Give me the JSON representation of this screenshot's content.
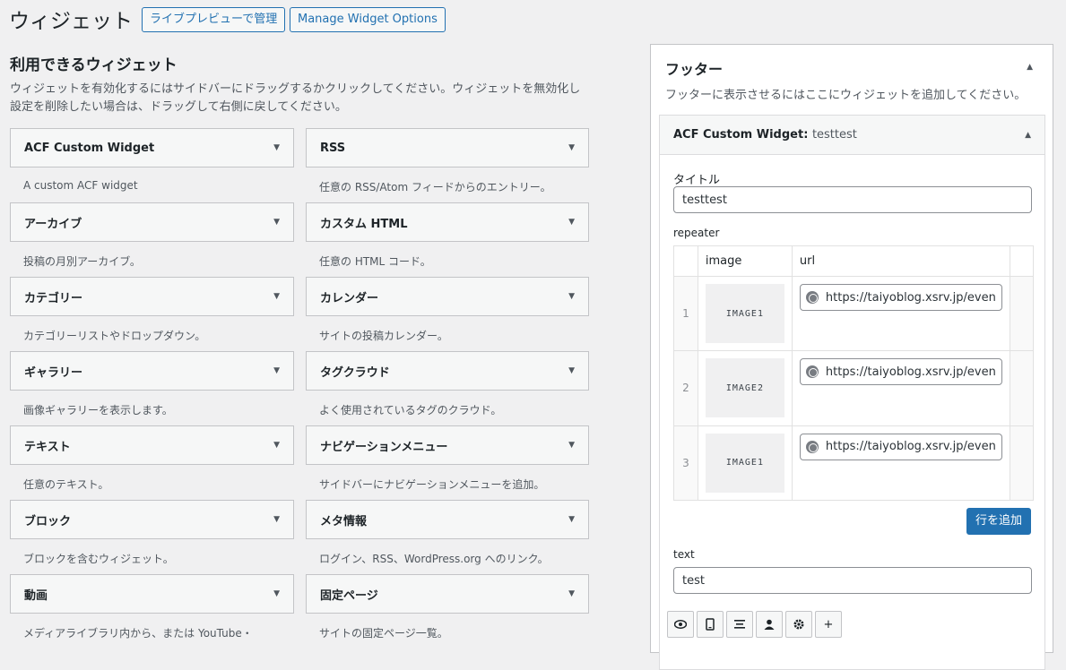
{
  "header": {
    "title": "ウィジェット",
    "live_preview_button": "ライブプレビューで管理",
    "manage_button": "Manage Widget Options"
  },
  "available": {
    "title": "利用できるウィジェット",
    "description": "ウィジェットを有効化するにはサイドバーにドラッグするかクリックしてください。ウィジェットを無効化し設定を削除したい場合は、ドラッグして右側に戻してください。",
    "description_line1": "ウィジェットを有効化するにはサイドバーにドラッグするかクリックしてください。ウィジェットを無効化し",
    "description_line2": "設定を削除したい場合は、ドラッグして右側に戻してください。",
    "widgets": [
      {
        "name": "ACF Custom Widget",
        "desc": "A custom ACF widget"
      },
      {
        "name": "RSS",
        "desc": "任意の RSS/Atom フィードからのエントリー。"
      },
      {
        "name": "アーカイブ",
        "desc": "投稿の月別アーカイブ。"
      },
      {
        "name": "カスタム HTML",
        "desc": "任意の HTML コード。"
      },
      {
        "name": "カテゴリー",
        "desc": "カテゴリーリストやドロップダウン。"
      },
      {
        "name": "カレンダー",
        "desc": "サイトの投稿カレンダー。"
      },
      {
        "name": "ギャラリー",
        "desc": "画像ギャラリーを表示します。"
      },
      {
        "name": "タグクラウド",
        "desc": "よく使用されているタグのクラウド。"
      },
      {
        "name": "テキスト",
        "desc": "任意のテキスト。"
      },
      {
        "name": "ナビゲーションメニュー",
        "desc": "サイドバーにナビゲーションメニューを追加。"
      },
      {
        "name": "ブロック",
        "desc": "ブロックを含むウィジェット。"
      },
      {
        "name": "メタ情報",
        "desc": "ログイン、RSS、WordPress.org へのリンク。"
      },
      {
        "name": "動画",
        "desc": "メディアライブラリ内から、または YouTube・"
      },
      {
        "name": "固定ページ",
        "desc": "サイトの固定ページ一覧。"
      }
    ]
  },
  "footer_sidebar": {
    "title": "フッター",
    "description": "フッターに表示させるにはここにウィジェットを追加してください。",
    "widget": {
      "title": "ACF Custom Widget:",
      "instance_title": "testtest",
      "title_label": "タイトル",
      "title_value": "testtest",
      "repeater_label": "repeater",
      "columns": [
        "image",
        "url"
      ],
      "rows": [
        {
          "num": "1",
          "image": "IMAGE1",
          "url": "https://taiyoblog.xsrv.jp/even"
        },
        {
          "num": "2",
          "image": "IMAGE2",
          "url": "https://taiyoblog.xsrv.jp/even"
        },
        {
          "num": "3",
          "image": "IMAGE1",
          "url": "https://taiyoblog.xsrv.jp/even"
        }
      ],
      "add_row_button": "行を追加",
      "text_label": "text",
      "text_value": "test",
      "toolbar_icons": [
        "eye-icon",
        "mobile-icon",
        "align-center-icon",
        "user-icon",
        "gear-icon",
        "plus-icon"
      ],
      "toolbar_plus": "+"
    }
  }
}
